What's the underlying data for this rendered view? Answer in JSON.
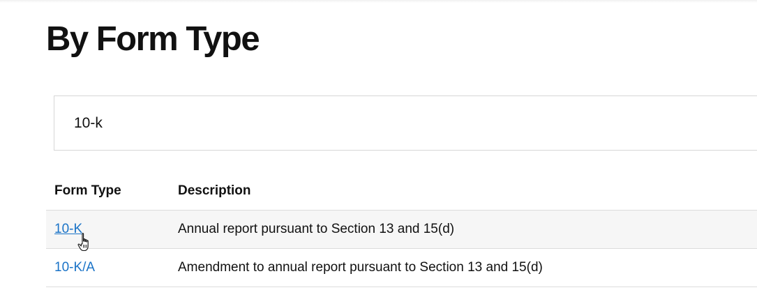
{
  "page": {
    "title": "By Form Type"
  },
  "search": {
    "value": "10-k"
  },
  "table": {
    "headers": [
      "Form Type",
      "Description"
    ],
    "rows": [
      {
        "form_type": "10-K",
        "description": "Annual report pursuant to Section 13 and 15(d)"
      },
      {
        "form_type": "10-K/A",
        "description": "Amendment to annual report pursuant to Section 13 and 15(d)"
      }
    ]
  },
  "colors": {
    "link": "#1a73c7",
    "row_alt_background": "#f6f6f6",
    "border": "#dcdcdc"
  },
  "icons": {
    "cursor": "hand-pointer-icon"
  }
}
